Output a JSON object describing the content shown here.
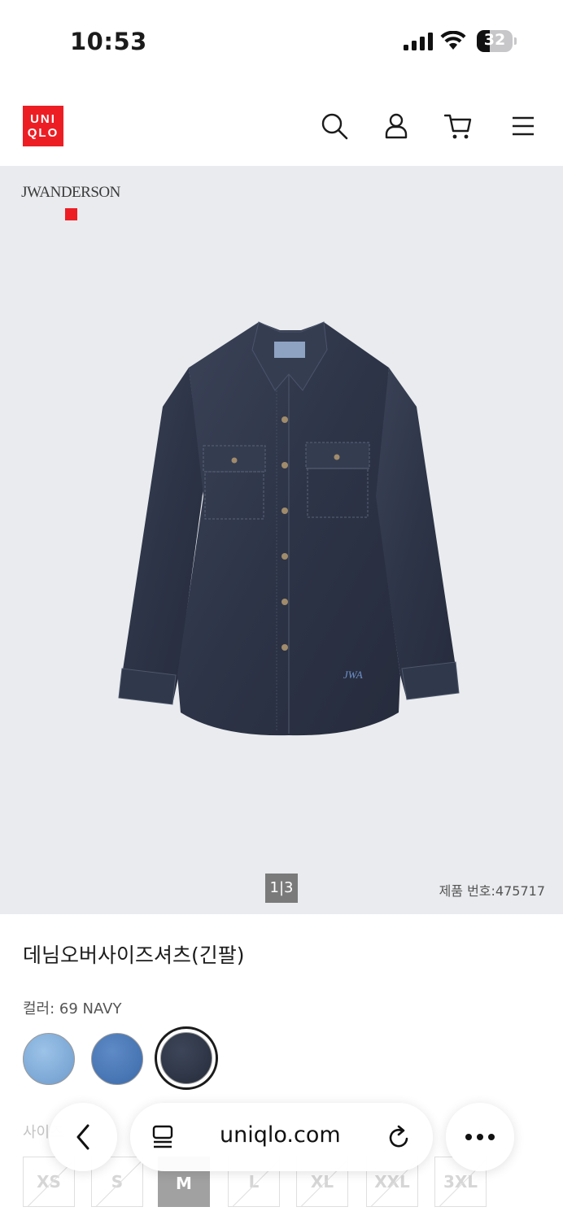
{
  "status_bar": {
    "time": "10:53",
    "battery": "32"
  },
  "header": {
    "logo_line1": "UNI",
    "logo_line2": "QLO"
  },
  "gallery": {
    "collab_brand": "JWANDERSON",
    "pager": "1|3",
    "product_number": "제품 번호:475717"
  },
  "product": {
    "title": "데님오버사이즈셔츠(긴팔)",
    "color_label": "컬러: 69 NAVY",
    "swatch_colors": [
      "#86b1dc",
      "#4a78b8",
      "#2c3444"
    ],
    "size_label": "사이즈: 여성 XS~XXL",
    "sizes": [
      "XS",
      "S",
      "M",
      "L",
      "XL",
      "XXL",
      "3XL"
    ],
    "selected_size": "M"
  },
  "browser": {
    "url": "uniqlo.com"
  }
}
